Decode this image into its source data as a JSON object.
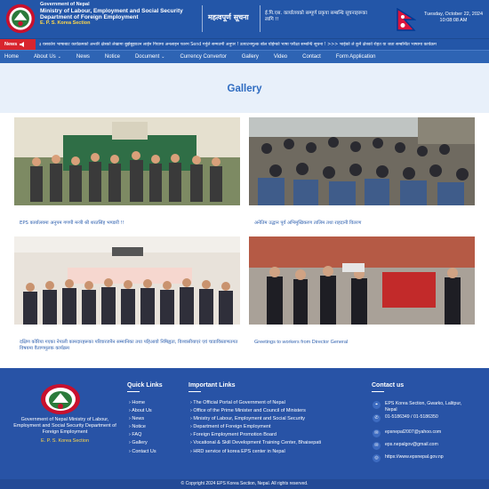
{
  "header": {
    "line1": "Government of Nepal",
    "line2": "Ministry of Labour, Employment and Social Security",
    "line3": "Department of Foreign Employment",
    "line4": "E. P. S. Korea Section",
    "important_title": "महत्वपूर्ण सूचना",
    "important_text": "ई.पि.एस. कार्यालयको सम्पूर्ण प्रकृया सम्बन्धि सूचनाहरूका लागि !!",
    "date": "Tuesday, October 22, 2024",
    "time": "10:08:08 AM"
  },
  "ticker": {
    "news_label": "News",
    "text": "३ यसकोरा भाषाबाट कार्यक्रमको अन्तरि क्षेत्रको लेखामा बुझेबुझाउन लाईन गियामा अनलाइन फारम Send गर्नुले सम्मतमी अनुपर !   उत्पाटनमूल्क बोल र्याईम्को भाषा परीक्षा सम्बन्धि सूचना !   >>> भाईको ले कुनै क्षेत्रको रोहत या जता सम्बन्धित भाषामा कार्यक्रम"
  },
  "nav": {
    "items": [
      {
        "label": "Home",
        "chevron": false
      },
      {
        "label": "About Us",
        "chevron": true
      },
      {
        "label": "News",
        "chevron": false
      },
      {
        "label": "Notice",
        "chevron": false
      },
      {
        "label": "Document",
        "chevron": true
      },
      {
        "label": "Currency Convertor",
        "chevron": false
      },
      {
        "label": "Gallery",
        "chevron": false
      },
      {
        "label": "Video",
        "chevron": false
      },
      {
        "label": "Contact",
        "chevron": false
      },
      {
        "label": "Form Application",
        "chevron": false
      }
    ]
  },
  "page": {
    "title": "Gallery"
  },
  "gallery": [
    {
      "caption": "EPS कार्यालयमा अनुपम गणपी मन्त्री श्री शरतसिंह भण्डारी !!",
      "en": false
    },
    {
      "caption": "अनेतिम उद्धान पूर्व अभिमुखिकरण तालिम तथा राहदानी वितरण",
      "en": false
    },
    {
      "caption": "दक्षिण कोरिया गएका नेपाली कामदारहरूका परिवारजनैन सम्मानिका तथा पहिआवो निषिह्वता, विश्वासीयाएरं एवं चाडाविस्ताणतगत विषयमा वैताणमूलक कार्यक्रम",
      "en": false
    },
    {
      "caption": "Greetings to workers from Director General",
      "en": true
    }
  ],
  "footer": {
    "org": "Government of Nepal Ministry of Labour, Employment and Social Security Department of Foreign Employment",
    "section": "E. P. S. Korea Section",
    "quick_title": "Quick Links",
    "quick_links": [
      "Home",
      "About Us",
      "News",
      "Notice",
      "FAQ",
      "Gallery",
      "Contact Us"
    ],
    "important_title": "Important Links",
    "important_links": [
      "The Official Portal of Government of Nepal",
      "Office of the Prime Minister and Council of Ministers",
      "Ministry of Labour, Employment and Social Security",
      "Department of Foreign Employment",
      "Foreign Employment Promotion Board",
      "Vocational & Skill Development Training Center, Bhaisepati",
      "HRD service of korea EPS center in Nepal"
    ],
    "contact_title": "Contact us",
    "contact": {
      "address": "EPS Korea Section, Gwarko, Lalitpur, Nepal",
      "phone": "01-5186349 / 01-5186350",
      "email1": "epsnepal2007@yahoo.com",
      "email2": "eps.nepalgov@gmail.com",
      "web": "https://www.epsnepal.gov.np"
    },
    "copyright": "© Copyright 2024 EPS Korea Section, Nepal. All rights reserved."
  },
  "colors": {
    "primary": "#2356a8",
    "news_red": "#d8252e",
    "gold": "#ffd84a",
    "link": "#2d5fae"
  }
}
